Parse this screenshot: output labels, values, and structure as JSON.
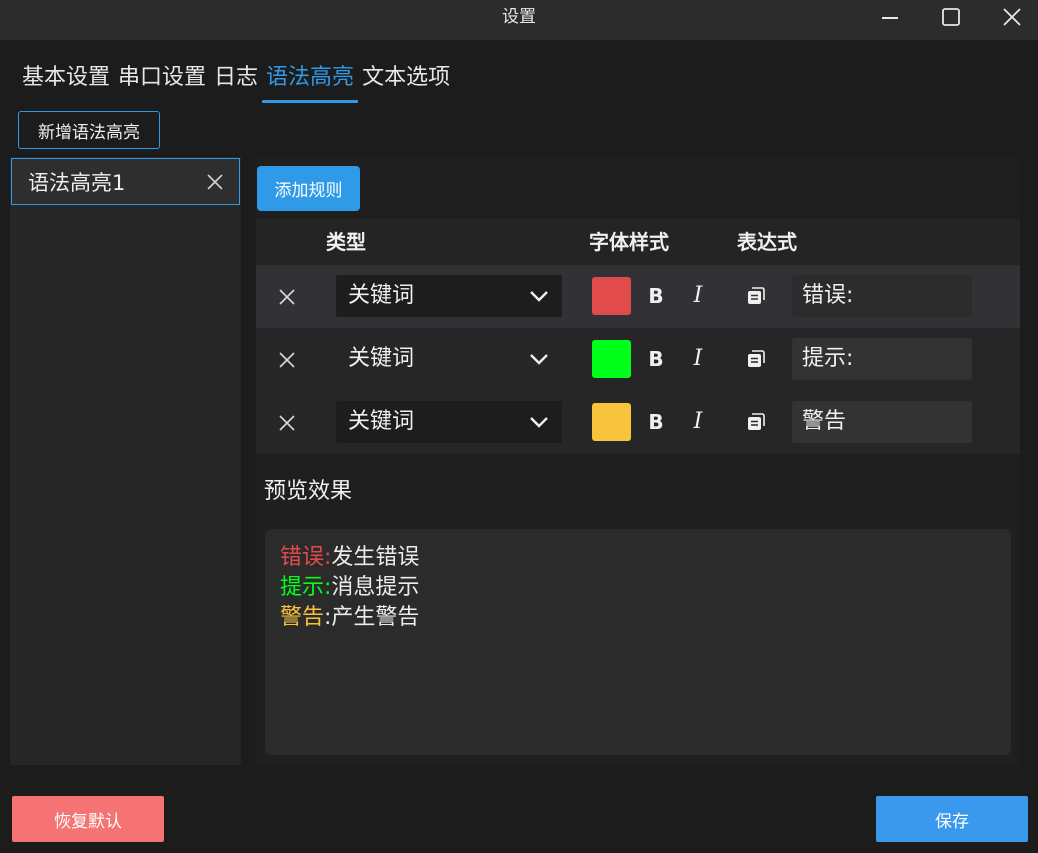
{
  "window": {
    "title": "设置"
  },
  "tabs": [
    {
      "label": "基本设置",
      "active": false
    },
    {
      "label": "串口设置",
      "active": false
    },
    {
      "label": "日志",
      "active": false
    },
    {
      "label": "语法高亮",
      "active": true
    },
    {
      "label": "文本选项",
      "active": false
    }
  ],
  "toolbar": {
    "add_highlight_label": "新增语法高亮"
  },
  "highlight_list": {
    "items": [
      {
        "label": "语法高亮1",
        "selected": true
      }
    ]
  },
  "rules": {
    "add_rule_label": "添加规则",
    "headers": {
      "type": "类型",
      "font_style": "字体样式",
      "expression": "表达式"
    },
    "rows": [
      {
        "type": "关键词",
        "color": "#e24b4b",
        "bold_label": "B",
        "italic_label": "I",
        "expression": "错误:"
      },
      {
        "type": "关键词",
        "color": "#00ff1a",
        "bold_label": "B",
        "italic_label": "I",
        "expression": "提示:"
      },
      {
        "type": "关键词",
        "color": "#f8c43d",
        "bold_label": "B",
        "italic_label": "I",
        "expression": "警告"
      }
    ]
  },
  "preview": {
    "label": "预览效果",
    "lines": [
      {
        "keyword": "错误:",
        "text": "发生错误",
        "color": "#e24b4b"
      },
      {
        "keyword": "提示:",
        "text": "消息提示",
        "color": "#00ff1a"
      },
      {
        "keyword": "警告",
        "text": ":产生警告",
        "color": "#f8c43d"
      }
    ]
  },
  "footer": {
    "restore_label": "恢复默认",
    "save_label": "保存"
  },
  "colors": {
    "accent": "#2f9ae8",
    "danger": "#f57373",
    "primary": "#3a99ec"
  }
}
